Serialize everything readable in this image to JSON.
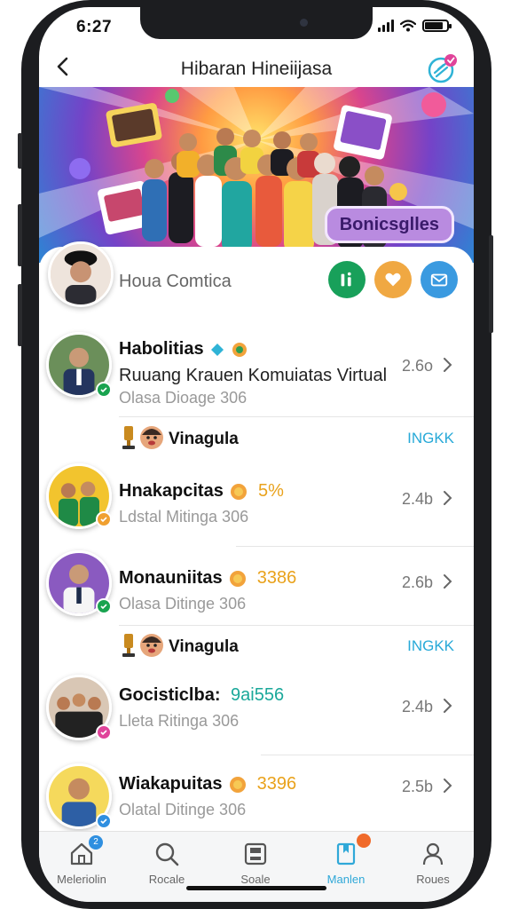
{
  "status_bar": {
    "time": "6:27"
  },
  "header": {
    "title": "Hibaran Hineiijasa",
    "back_icon": "back-arrow-icon",
    "badge_icon": "notification-badge-icon"
  },
  "banner": {
    "label": "Bonicsglles"
  },
  "profile": {
    "name": "Houa Comtica"
  },
  "colors": {
    "accent": "#27a9d8",
    "orange": "#e9a21c",
    "green": "#16a34a",
    "teal": "#1aa89a"
  },
  "list": {
    "items": [
      {
        "title": "Habolitias",
        "subtitle": "Ruuang Krauen Komuiatas Virtual",
        "meta": "Olasa Dioage 306",
        "value": "2.6o"
      },
      {
        "title": "Hnakapcitas",
        "stat": "5%",
        "meta": "Ldstal Mitinga 306",
        "value": "2.4b"
      },
      {
        "title": "Monauniitas",
        "stat": "3386",
        "meta": "Olasa Ditinge 306",
        "value": "2.6b"
      },
      {
        "title": "Gocisticlba:",
        "stat": "9ai556",
        "meta": "Lleta Ritinga 306",
        "value": "2.4b"
      },
      {
        "title": "Wiakapuitas",
        "stat": "3396",
        "meta": "Olatal Ditinge 306",
        "value": "2.5b"
      }
    ],
    "separators": [
      {
        "label": "Vinagula",
        "link": "INGKK"
      },
      {
        "label": "Vinagula",
        "link": "INGKK"
      }
    ]
  },
  "tabbar": {
    "tabs": [
      {
        "label": "Meleriolin",
        "icon": "home-icon",
        "badge": "2"
      },
      {
        "label": "Rocale",
        "icon": "search-icon"
      },
      {
        "label": "Soale",
        "icon": "save-icon"
      },
      {
        "label": "Manlen",
        "icon": "bookmark-icon"
      },
      {
        "label": "Roues",
        "icon": "user-icon"
      }
    ]
  }
}
